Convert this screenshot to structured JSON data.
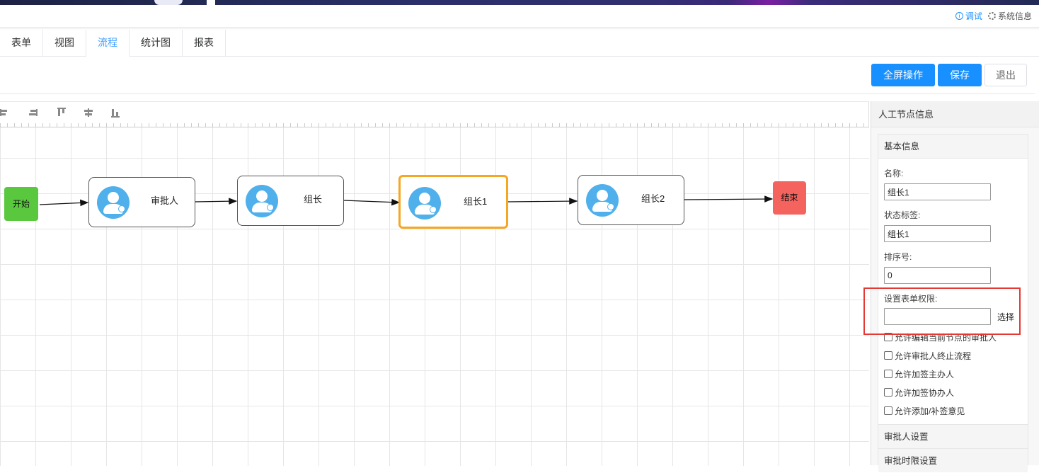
{
  "header": {
    "debug_label": "调试",
    "system_label": "系统信息",
    "debug_icon": "info-icon",
    "system_icon": "gear-icon"
  },
  "tabs": [
    {
      "label": "表单",
      "active": false
    },
    {
      "label": "视图",
      "active": false
    },
    {
      "label": "流程",
      "active": true
    },
    {
      "label": "统计图",
      "active": false
    },
    {
      "label": "报表",
      "active": false
    }
  ],
  "actions": {
    "fullscreen_label": "全屏操作",
    "save_label": "保存",
    "exit_label": "退出"
  },
  "toolbar": {
    "icons": [
      "align-left-icon",
      "align-right-icon",
      "align-top-icon",
      "align-middle-icon",
      "align-bottom-icon"
    ]
  },
  "flow": {
    "start_label": "开始",
    "end_label": "结束",
    "nodes": [
      {
        "label": "审批人",
        "selected": false
      },
      {
        "label": "组长",
        "selected": false
      },
      {
        "label": "组长1",
        "selected": true
      },
      {
        "label": "组长2",
        "selected": false
      }
    ]
  },
  "panel": {
    "title": "人工节点信息",
    "basic_section": "基本信息",
    "name_label": "名称:",
    "name_value": "组长1",
    "status_label": "状态标签:",
    "status_value": "组长1",
    "order_label": "排序号:",
    "order_value": "0",
    "form_perm_label": "设置表单权限:",
    "form_perm_value": "",
    "select_label": "选择",
    "checkboxes": [
      {
        "label": "允许编辑当前节点的审批人",
        "checked": false
      },
      {
        "label": "允许审批人终止流程",
        "checked": false
      },
      {
        "label": "允许加签主办人",
        "checked": false
      },
      {
        "label": "允许加签协办人",
        "checked": false
      },
      {
        "label": "允许添加/补签意见",
        "checked": false
      }
    ],
    "approver_section": "审批人设置",
    "time_section": "审批时限设置"
  },
  "colors": {
    "accent": "#1890ff",
    "start": "#5ac83f",
    "end": "#f5635f",
    "selected_border": "#f5a623",
    "highlight": "#e53935"
  }
}
